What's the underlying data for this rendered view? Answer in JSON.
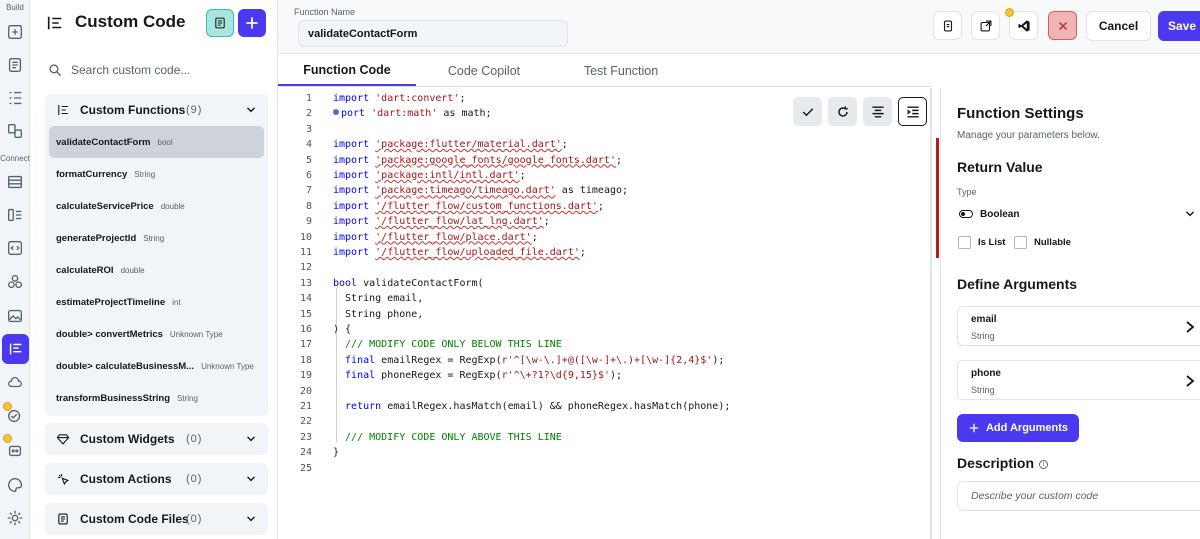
{
  "rail": {
    "build_label": "Build",
    "connect_label": "Connect"
  },
  "sidebar": {
    "title": "Custom Code",
    "search_placeholder": "Search custom code...",
    "groups": [
      {
        "label": "Custom Functions",
        "count": "(9)"
      },
      {
        "label": "Custom Widgets",
        "count": "(0)"
      },
      {
        "label": "Custom Actions",
        "count": "(0)"
      },
      {
        "label": "Custom Code Files",
        "count": "(0)"
      }
    ],
    "functions": [
      {
        "name": "validateContactForm",
        "type": "bool"
      },
      {
        "name": "formatCurrency",
        "type": "String"
      },
      {
        "name": "calculateServicePrice",
        "type": "double"
      },
      {
        "name": "generateProjectId",
        "type": "String"
      },
      {
        "name": "calculateROI",
        "type": "double"
      },
      {
        "name": "estimateProjectTimeline",
        "type": "int"
      },
      {
        "name": "double> convertMetrics",
        "type": "Unknown Type"
      },
      {
        "name": "double> calculateBusinessM...",
        "type": "Unknown Type"
      },
      {
        "name": "transformBusinessString",
        "type": "String"
      }
    ]
  },
  "topbar": {
    "function_name_label": "Function Name",
    "function_name_value": "validateContactForm",
    "cancel_label": "Cancel",
    "save_label": "Save"
  },
  "tabs": [
    {
      "label": "Function Code"
    },
    {
      "label": "Code Copilot"
    },
    {
      "label": "Test Function"
    }
  ],
  "code": {
    "line_numbers": [
      "1",
      "2",
      "3",
      "4",
      "5",
      "6",
      "7",
      "8",
      "9",
      "10",
      "11",
      "12",
      "13",
      "14",
      "15",
      "16",
      "17",
      "18",
      "19",
      "20",
      "21",
      "22",
      "23",
      "24",
      "25"
    ],
    "l1_kw": "import",
    "l1_str": "'dart:convert'",
    "l1_end": ";",
    "l2_kw": "port",
    "l2_str": "'dart:math'",
    "l2_rest": " as math;",
    "l4_kw": "import",
    "l4_str": "'package:flutter/material.dart'",
    "l4_end": ";",
    "l5_kw": "import",
    "l5_str": "'package:google_fonts/google_fonts.dart'",
    "l5_end": ";",
    "l6_kw": "import",
    "l6_str": "'package:intl/intl.dart'",
    "l6_end": ";",
    "l7_kw": "import",
    "l7_str": "'package:timeago/timeago.dart'",
    "l7_rest": " as timeago;",
    "l8_kw": "import",
    "l8_str": "'/flutter_flow/custom_functions.dart'",
    "l8_end": ";",
    "l9_kw": "import",
    "l9_str": "'/flutter_flow/lat_lng.dart'",
    "l9_end": ";",
    "l10_kw": "import",
    "l10_str": "'/flutter_flow/place.dart'",
    "l10_end": ";",
    "l11_kw": "import",
    "l11_str": "'/flutter_flow/uploaded_file.dart'",
    "l11_end": ";",
    "l13_kw": "bool",
    "l13_rest": " validateContactForm(",
    "l14": "  String email,",
    "l15": "  String phone,",
    "l16": ") {",
    "l17": "  /// MODIFY CODE ONLY BELOW THIS LINE",
    "l18_kw": "  final",
    "l18_rest": " emailRegex = RegExp(",
    "l18_str": "r'^[\\w-\\.]+@([\\w-]+\\.)+[\\w-]{2,4}$'",
    "l18_end": ");",
    "l19_kw": "  final",
    "l19_rest": " phoneRegex = RegExp(",
    "l19_str": "r'^\\+?1?\\d{9,15}$'",
    "l19_end": ");",
    "l21_kw": "  return",
    "l21_rest": " emailRegex.hasMatch(email) && phoneRegex.hasMatch(phone);",
    "l23": "  /// MODIFY CODE ONLY ABOVE THIS LINE",
    "l24": "}"
  },
  "settings": {
    "title": "Function Settings",
    "subtitle": "Manage your parameters below.",
    "return_value_heading": "Return Value",
    "type_label": "Type",
    "type_value": "Boolean",
    "is_list_label": "Is List",
    "nullable_label": "Nullable",
    "define_args_heading": "Define Arguments",
    "arguments": [
      {
        "name": "email",
        "type": "String"
      },
      {
        "name": "phone",
        "type": "String"
      }
    ],
    "add_arguments_label": "Add Arguments",
    "description_heading": "Description",
    "description_placeholder": "Describe your custom code"
  },
  "colors": {
    "accent": "#4b39ef",
    "selected_row": "#ced3d9",
    "close_button": "#f0b4b4",
    "error_bar": "#b71c1c"
  }
}
